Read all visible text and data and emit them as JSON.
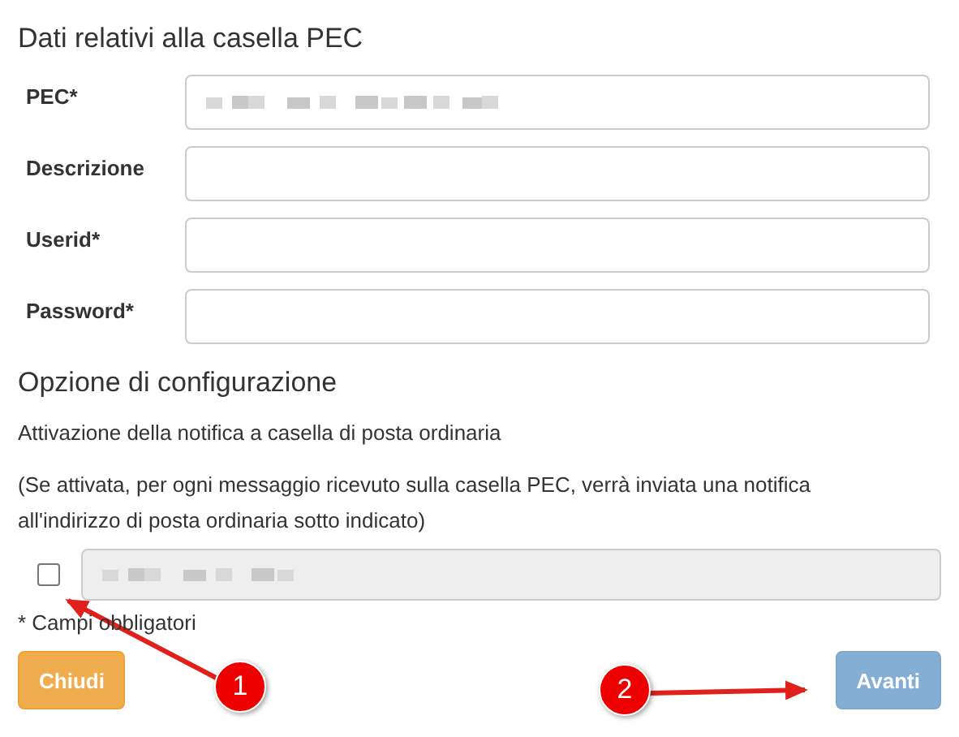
{
  "section_title": "Dati relativi alla casella PEC",
  "fields": [
    {
      "label": "PEC*",
      "value_hidden": true
    },
    {
      "label": "Descrizione",
      "value_hidden": false
    },
    {
      "label": "Userid*",
      "value_hidden": false
    },
    {
      "label": "Password*",
      "value_hidden": false
    }
  ],
  "options_title": "Opzione di configurazione",
  "notification_label": "Attivazione della notifica a casella di posta ordinaria",
  "notification_note": "(Se attivata, per ogni messaggio ricevuto sulla casella PEC, verrà inviata una notifica all'indirizzo di posta ordinaria sotto indicato)",
  "notification": {
    "checked": false,
    "disabled": true,
    "value_hidden": true
  },
  "required_note": "* Campi obbligatori",
  "buttons": [
    {
      "label": "Chiudi",
      "kind": "warning",
      "disabled": false
    },
    {
      "label": "Avanti",
      "kind": "primary",
      "disabled": true
    }
  ],
  "callouts": [
    "1",
    "2"
  ]
}
